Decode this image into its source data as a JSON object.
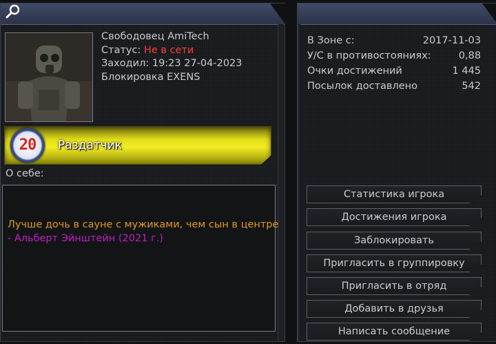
{
  "profile": {
    "name": "Свободовец AmiTech",
    "status_label": "Статус:",
    "status_value": "Не в сети",
    "last_seen": "Заходил: 19:23 27-04-2023",
    "block_note": "Блокировка EXENS",
    "rank_level": "20",
    "rank_title": "Раздатчик",
    "about_label": "О себе:",
    "quote_line1": "Лучше дочь в сауне с мужиками, чем сын в центре",
    "quote_line2": "- Альберт Эйнштейн (2021 г.)"
  },
  "stats": [
    {
      "label": "В Зоне с:",
      "value": "2017-11-03"
    },
    {
      "label": "У/С в противостояниях:",
      "value": "0,88"
    },
    {
      "label": "Очки достижений",
      "value": "1 445"
    },
    {
      "label": "Посылок доставлено",
      "value": "542"
    }
  ],
  "actions": [
    {
      "label": "Статистика игрока"
    },
    {
      "label": "Достижения игрока"
    },
    {
      "label": "Заблокировать"
    },
    {
      "label": "Пригласить в группировку"
    },
    {
      "label": "Пригласить в отряд"
    },
    {
      "label": "Добавить в друзья"
    },
    {
      "label": "Написать сообщение"
    }
  ],
  "colors": {
    "header": "#353d58",
    "status_offline": "#ff3b3b",
    "quote_text": "#e39a1e",
    "quote_author": "#c21fc4",
    "rank_bar": "#e5df1a"
  },
  "icons": [
    "search-icon"
  ]
}
